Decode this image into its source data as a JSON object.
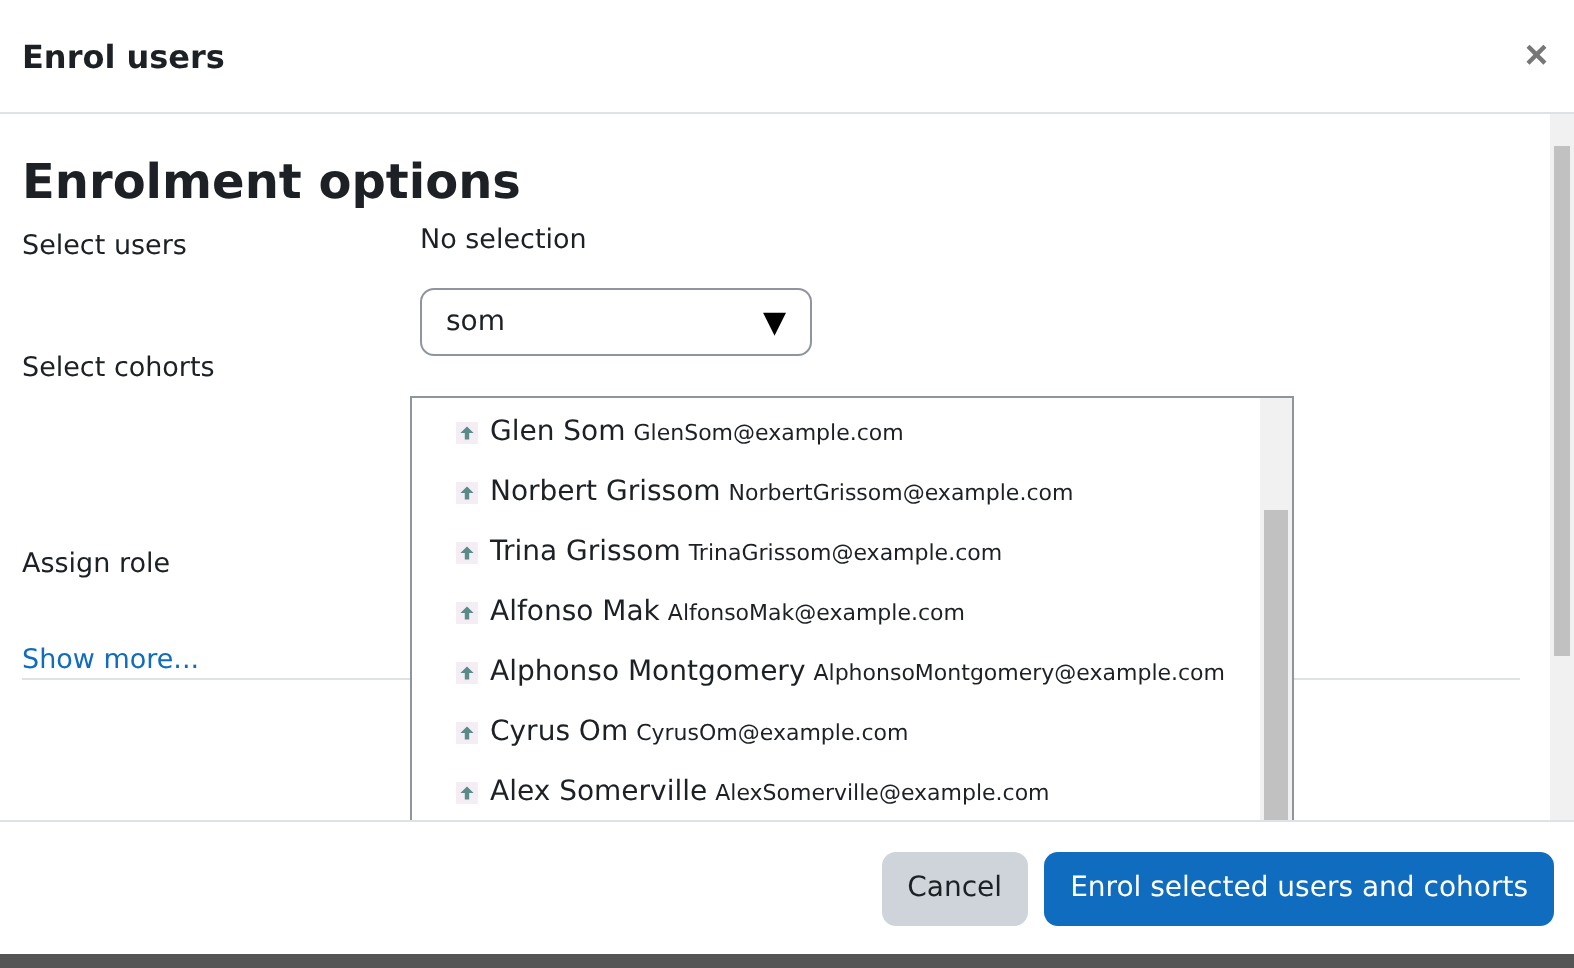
{
  "dialog": {
    "title": "Enrol users",
    "close": "×"
  },
  "heading": "Enrolment options",
  "fields": [
    {
      "label": "Select users"
    },
    {
      "label": "Select cohorts"
    },
    {
      "label": "Assign role"
    }
  ],
  "selection_text": "No selection",
  "search": {
    "value": "som",
    "caret": "▼"
  },
  "suggestions": [
    {
      "name": "Glen Som",
      "email": "GlenSom@example.com"
    },
    {
      "name": "Norbert Grissom",
      "email": "NorbertGrissom@example.com"
    },
    {
      "name": "Trina Grissom",
      "email": "TrinaGrissom@example.com"
    },
    {
      "name": "Alfonso Mak",
      "email": "AlfonsoMak@example.com"
    },
    {
      "name": "Alphonso Montgomery",
      "email": "AlphonsoMontgomery@example.com"
    },
    {
      "name": "Cyrus Om",
      "email": "CyrusOm@example.com"
    },
    {
      "name": "Alex Somerville",
      "email": "AlexSomerville@example.com"
    }
  ],
  "show_more": "Show more...",
  "buttons": [
    {
      "label": "Cancel",
      "kind": "secondary"
    },
    {
      "label": "Enrol selected users and cohorts",
      "kind": "primary"
    }
  ]
}
